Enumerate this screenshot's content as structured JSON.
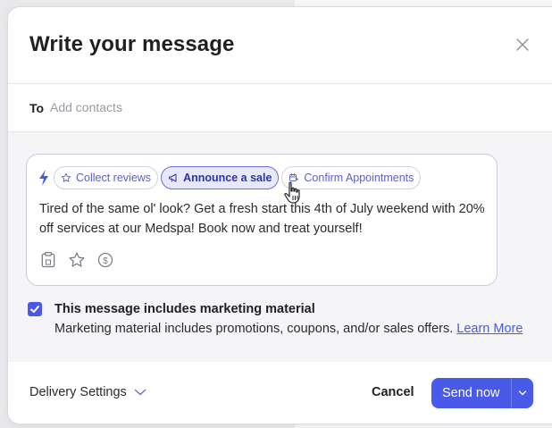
{
  "modal": {
    "title": "Write your message"
  },
  "to": {
    "label": "To",
    "placeholder": "Add contacts",
    "value": ""
  },
  "compose": {
    "chips": [
      {
        "label": "Collect reviews",
        "icon": "star-icon",
        "active": false
      },
      {
        "label": "Announce a sale",
        "icon": "megaphone-icon",
        "active": true
      },
      {
        "label": "Confirm Appointments",
        "icon": "calendar-icon",
        "active": false
      }
    ],
    "message": "Tired of the same ol' look? Get a fresh start this 4th of July weekend with 20% off services at our Medspa! Book now and treat yourself!"
  },
  "marketing": {
    "checked": true,
    "title": "This message includes marketing material",
    "description": "Marketing material includes promotions, coupons, and/or sales offers.",
    "link": "Learn More"
  },
  "footer": {
    "delivery_label": "Delivery Settings",
    "cancel_label": "Cancel",
    "send_label": "Send now"
  },
  "colors": {
    "accent": "#4a5ae8",
    "chip_text": "#5c60c9",
    "bolt": "#4a5ae8"
  }
}
